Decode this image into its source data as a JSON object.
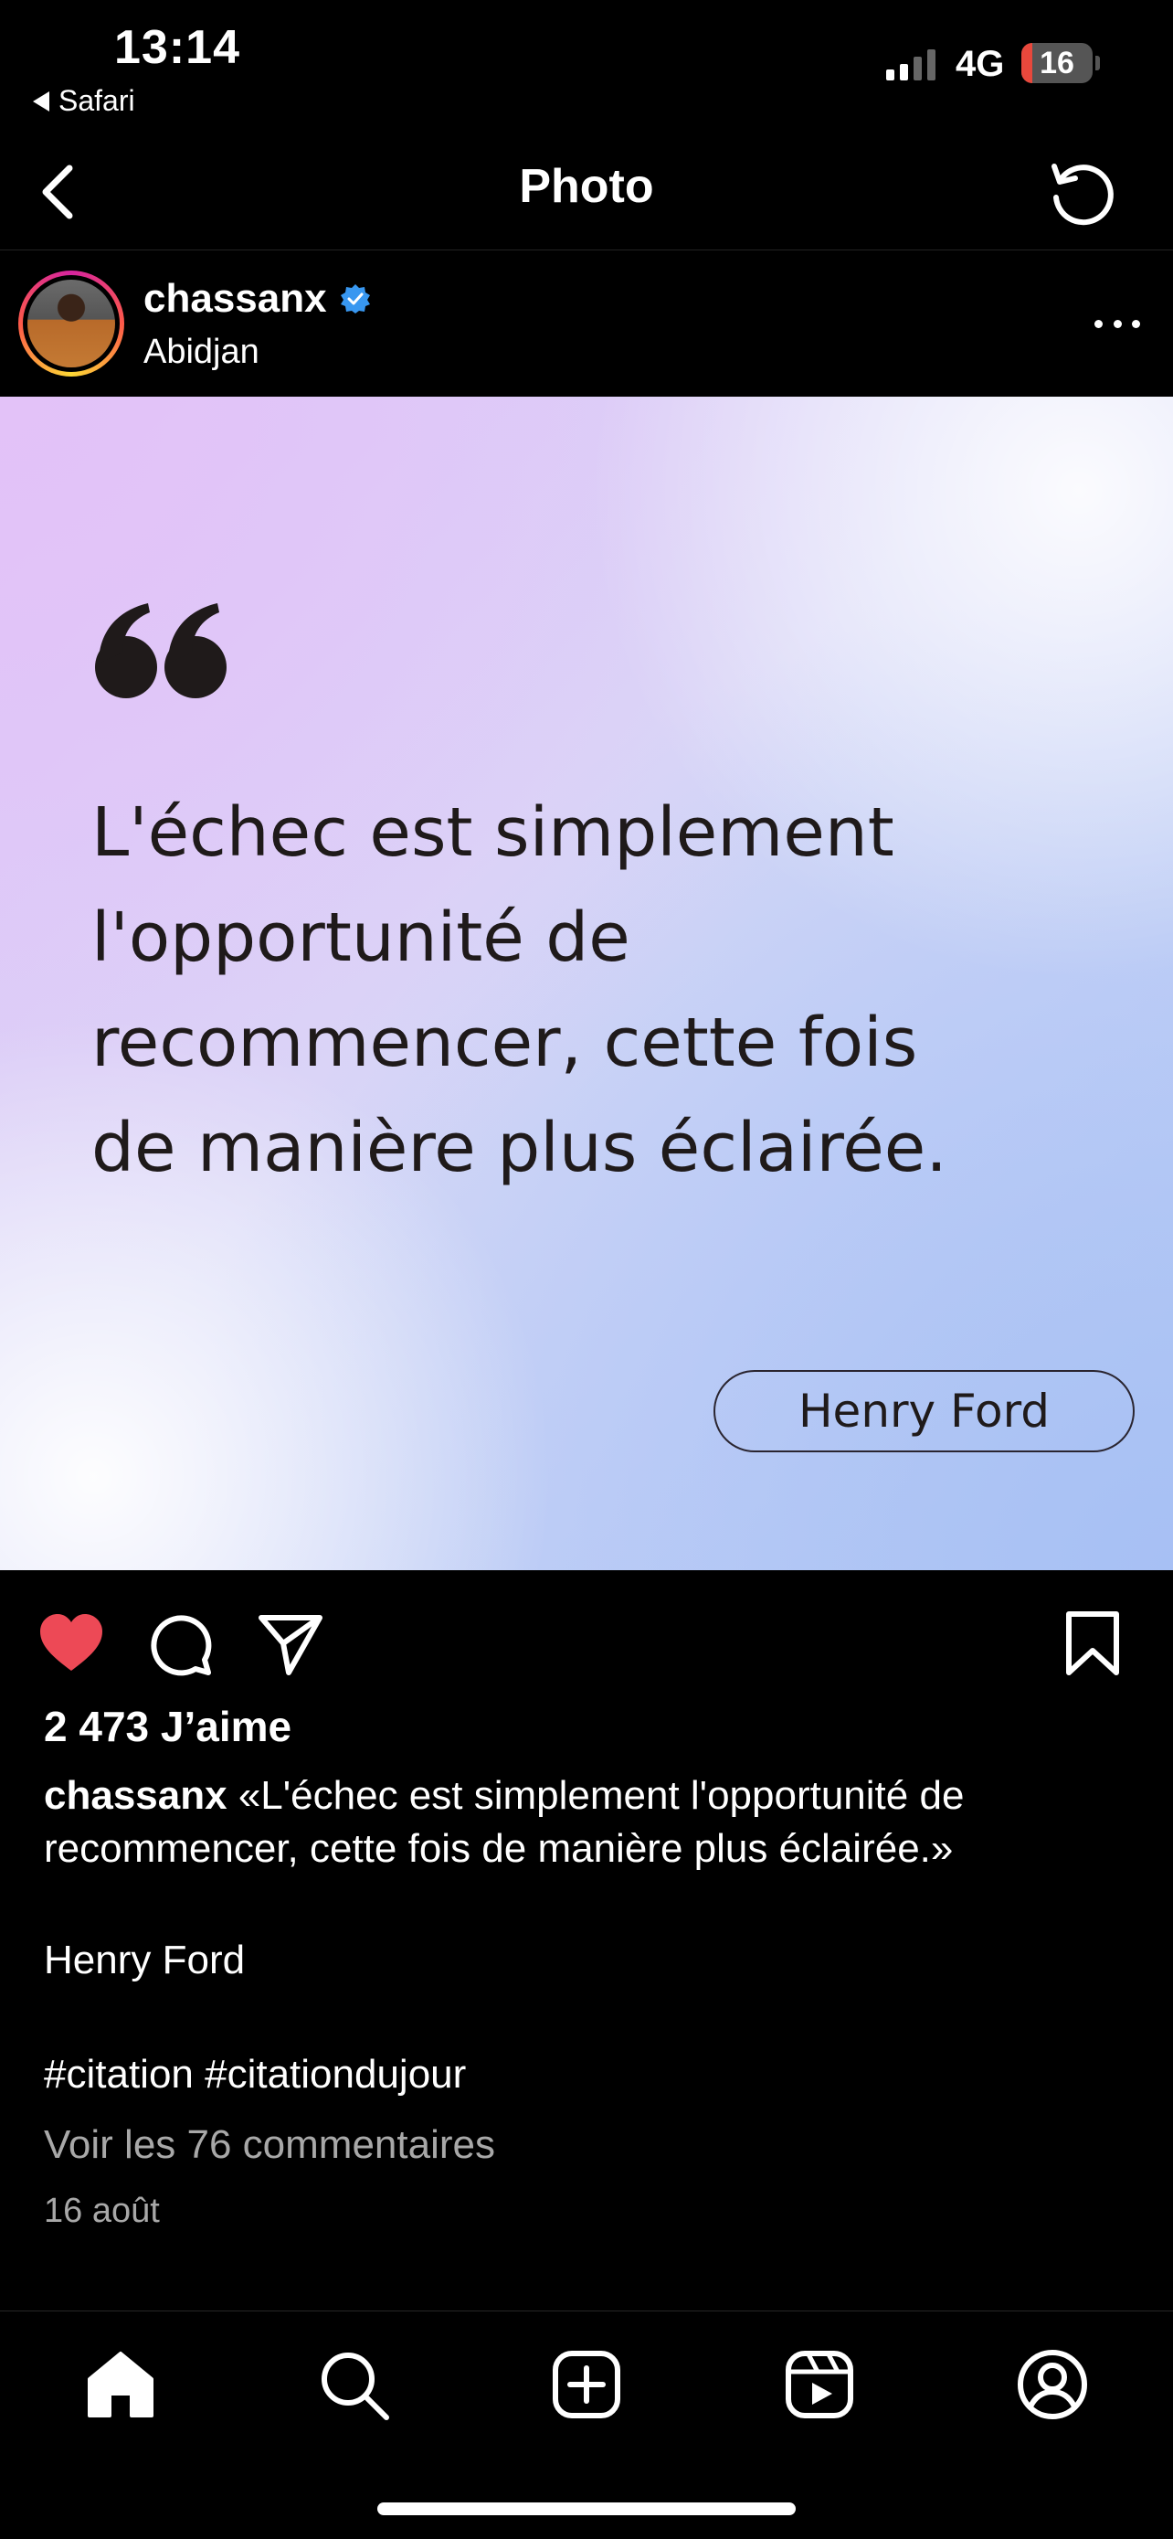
{
  "status_bar": {
    "time": "13:14",
    "back_app": "Safari",
    "network": "4G",
    "battery_level": "16",
    "battery_color": "#e8483c"
  },
  "nav": {
    "title": "Photo",
    "back_icon": "chevron-left-icon",
    "refresh_icon": "refresh-icon"
  },
  "post": {
    "username": "chassanx",
    "verified": true,
    "location": "Abidjan",
    "image": {
      "quote_lines": [
        "L'échec est simplement",
        "l'opportunité de",
        "recommencer, cette fois",
        "de manière plus éclairée."
      ],
      "author": "Henry Ford"
    },
    "liked": true,
    "like_color": "#ed4956",
    "likes_label": "2 473 J’aime",
    "caption_text": "«L'échec est simplement l'opportunité de recommencer, cette fois de manière plus éclairée.»",
    "caption_author": "Henry Ford",
    "hashtags": "#citation #citationdujour",
    "comments_link": "Voir les 76 commentaires",
    "date": "16 août"
  },
  "tab_bar": {
    "items": [
      "home-icon",
      "search-icon",
      "create-icon",
      "reels-icon",
      "profile-icon"
    ]
  }
}
